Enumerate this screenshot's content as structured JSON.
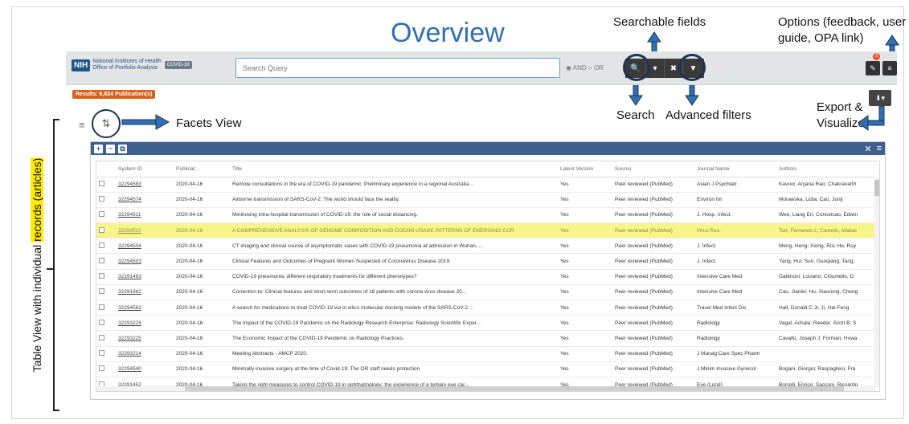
{
  "overview_title": "Overview",
  "callouts": {
    "searchable_fields": "Searchable fields",
    "options_line1": "Options (feedback, user",
    "options_line2": "guide, OPA link)",
    "search": "Search",
    "advanced_filters": "Advanced filters",
    "export_line1": "Export &",
    "export_line2": "Visualize",
    "facets_view": "Facets View",
    "table_view_pre": "Table View with individual ",
    "table_view_hl": "records (articles)"
  },
  "header": {
    "nih": "NIH",
    "org_line1": "National Institutes of Health",
    "org_line2": "Office of Portfolio Analysis",
    "covid_badge": "COVID-19",
    "search_placeholder": "Search Query",
    "and_label": "AND",
    "or_label": "OR",
    "notif_count": "3",
    "icons": [
      "search-icon",
      "dropdown-icon",
      "clear-icon",
      "filter-icon",
      "feedback-icon",
      "menu-icon"
    ]
  },
  "results_badge": "Results: 6,824 Publication(s)",
  "export_icon": "download-icon",
  "table": {
    "columns": [
      "",
      "System ID",
      "Publicat...",
      "Title",
      "Latest Version",
      "Source",
      "Journal Name",
      "Authors"
    ],
    "rows": [
      [
        "32294583",
        "2020-04-16",
        "Remote consultations in the era of COVID-19 pandemic: Preliminary experience in a regional Australia...",
        "Yes",
        "Peer reviewed (PubMed)",
        "Asian J Psychiatr",
        "Kavoor, Anjana Rao; Chakravarth"
      ],
      [
        "32294574",
        "2020-04-16",
        "Airborne transmission of SARS-CoV-2: The world should face the reality.",
        "Yes",
        "Peer reviewed (PubMed)",
        "Environ Int",
        "Morawska, Lidia; Cao, Junji"
      ],
      [
        "32294511",
        "2020-04-16",
        "Minimising intra-hospital transmission of COVID-19: the role of social distancing.",
        "Yes",
        "Peer reviewed (PubMed)",
        "J. Hosp. Infect.",
        "Wee, Liang En; Conceicao, Edwin"
      ],
      [
        "32294510",
        "2020-04-16",
        "A COMPREHENSIVE ANALYSIS OF GENOME COMPOSITION AND CODON USAGE PATTERNS OF EMERGING COR",
        "Yes",
        "Peer reviewed (PubMed)",
        "Virus Res.",
        "Tort, Fernando L; Castells, Matias"
      ],
      [
        "32294504",
        "2020-04-16",
        "CT imaging and clinical course of asymptomatic cases with COVID-19 pneumonia at admission in Wuhan, ...",
        "Yes",
        "Peer reviewed (PubMed)",
        "J. Infect.",
        "Meng, Heng; Xiong, Rui; He, Ruy"
      ],
      [
        "32294503",
        "2020-04-16",
        "Clinical Features and Outcomes of Pregnant Women Suspected of Coronavirus Disease 2019.",
        "Yes",
        "Peer reviewed (PubMed)",
        "J. Infect.",
        "Yang, Hui; Sun, Guoqiang; Tang,"
      ],
      [
        "32291463",
        "2020-04-16",
        "COVID-19 pneumonia: different respiratory treatments for different phenotypes?",
        "Yes",
        "Peer reviewed (PubMed)",
        "Intensive Care Med",
        "Gattinoni, Luciano; Chiumello, D"
      ],
      [
        "32291862",
        "2020-04-16",
        "Correction to: Clinical features and short-term outcomes of 18 patients with corona virus disease 20...",
        "Yes",
        "Peer reviewed (PubMed)",
        "Intensive Care Med",
        "Cao, Jianlei; Hu, Xiaorong; Cheng"
      ],
      [
        "32294562",
        "2020-04-16",
        "A search for medications to treat COVID-19 via in silico molecular docking models of the SARS-CoV-2 ...",
        "Yes",
        "Peer reviewed (PubMed)",
        "Travel Med Infect Dis",
        "Hall, Donald C Jr, Ji, Hai-Feng"
      ],
      [
        "32293224",
        "2020-04-16",
        "The Impact of the COVID-19 Pandemic on the Radiology Research Enterprise: Radiology Scientific Exper...",
        "Yes",
        "Peer reviewed (PubMed)",
        "Radiology",
        "Vagal, Achala; Reeder, Scott B; S"
      ],
      [
        "32293225",
        "2020-04-16",
        "The Economic Impact of the COVID-19 Pandemic on Radiology Practices.",
        "Yes",
        "Peer reviewed (PubMed)",
        "Radiology",
        "Cavallo, Joseph J; Forman, Howa"
      ],
      [
        "32293214",
        "2020-04-16",
        "Meeting Abstracts - AMCP 2020.",
        "Yes",
        "Peer reviewed (PubMed)",
        "J Manag Care Spec Pharm",
        ""
      ],
      [
        "32294540",
        "2020-04-16",
        "Minimally invasive surgery at the time of Covid-19: The OR staff needs protection.",
        "Yes",
        "Peer reviewed (PubMed)",
        "J Minim Invasive Gynecol",
        "Bogani, Giorgio; Raspagliesi, Fra"
      ],
      [
        "32291452",
        "2020-04-16",
        "Taking the right measures to control COVID-19 in ophthalmology: the experience of a tertiary eye car...",
        "Yes",
        "Peer reviewed (PubMed)",
        "Eye (Lond)",
        "Borrelli, Enrico; Sacconi, Riccardo"
      ]
    ],
    "highlighted_row": 3
  }
}
